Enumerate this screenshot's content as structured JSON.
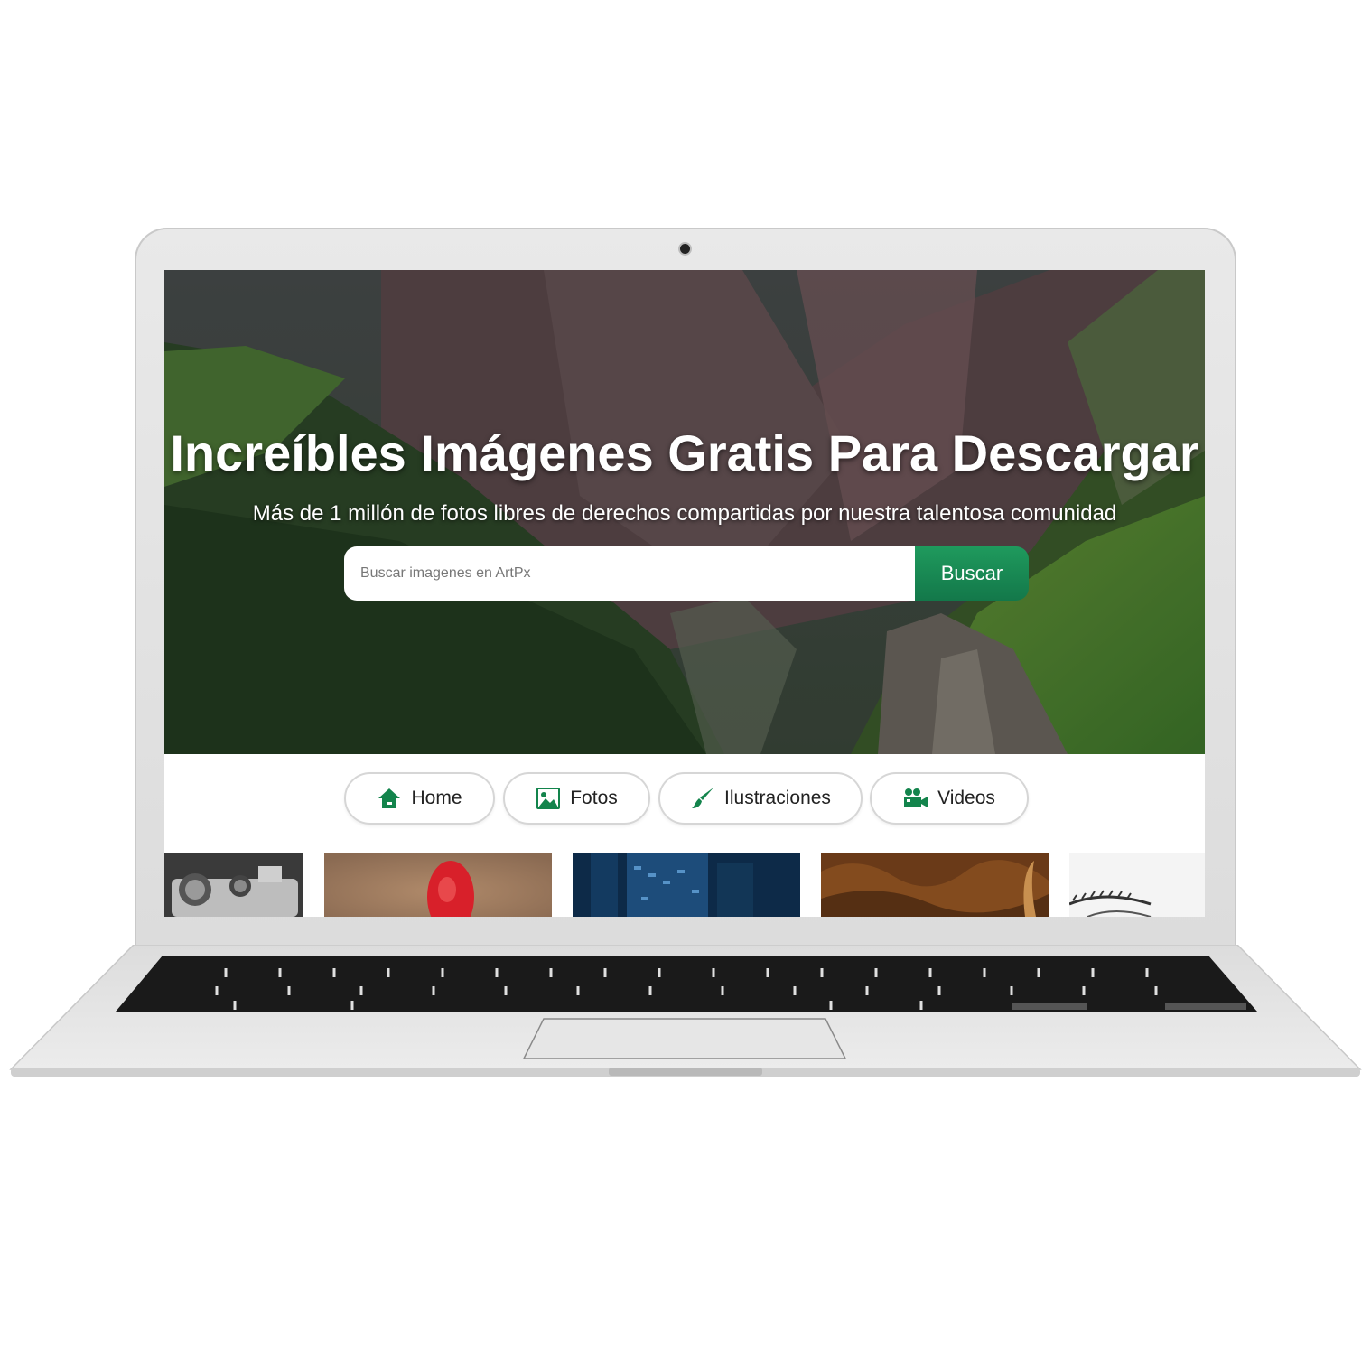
{
  "hero": {
    "title": "Increíbles Imágenes Gratis Para Descargar",
    "subtitle": "Más de 1 millón de fotos libres de derechos compartidas por nuestra talentosa comunidad"
  },
  "search": {
    "placeholder": "Buscar imagenes en ArtPx",
    "value": "",
    "button_label": "Buscar"
  },
  "categories": [
    {
      "label": "Home",
      "icon": "home-icon"
    },
    {
      "label": "Fotos",
      "icon": "image-icon"
    },
    {
      "label": "Ilustraciones",
      "icon": "paintbrush-icon"
    },
    {
      "label": "Videos",
      "icon": "video-camera-icon"
    }
  ],
  "thumbnails": [
    {
      "subject": "camera"
    },
    {
      "subject": "red-object"
    },
    {
      "subject": "city-building"
    },
    {
      "subject": "texture"
    },
    {
      "subject": "eye"
    }
  ],
  "theme": {
    "accent": "#1a8a52",
    "icon_color": "#13844c"
  }
}
